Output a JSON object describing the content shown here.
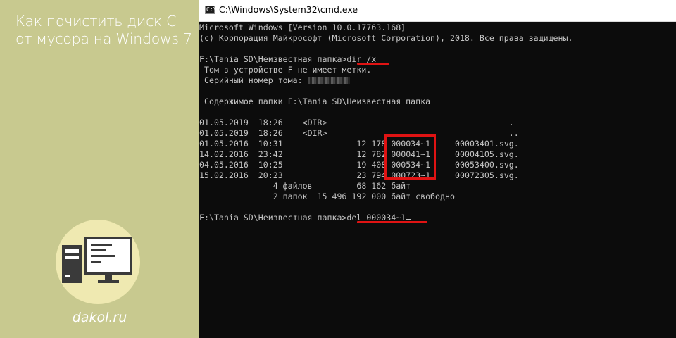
{
  "sidebar": {
    "title": "Как почистить диск С от мусора на Windows 7",
    "site": "dakol.ru",
    "logo_icon": "computer-icon"
  },
  "window": {
    "title": "C:\\Windows\\System32\\cmd.exe",
    "icon": "cmd-icon",
    "icon_glyph": "C:\\"
  },
  "console": {
    "version": "Microsoft Windows [Version 10.0.17763.168]",
    "copyright": "(c) Корпорация Майкрософт (Microsoft Corporation), 2018. Все права защищены.",
    "prompt1": "F:\\Tania SD\\Неизвестная папка>",
    "command1": "dir /x",
    "volume_label": " Том в устройстве F не имеет метки.",
    "serial_label": " Серийный номер тома: ",
    "folder_contents": " Содержимое папки F:\\Tania SD\\Неизвестная папка",
    "rows": [
      {
        "date": "01.05.2019",
        "time": "18:26",
        "dir": "<DIR>",
        "size": "",
        "short": "",
        "name": "."
      },
      {
        "date": "01.05.2019",
        "time": "18:26",
        "dir": "<DIR>",
        "size": "",
        "short": "",
        "name": ".."
      },
      {
        "date": "01.05.2016",
        "time": "10:31",
        "dir": "",
        "size": "12 178",
        "short": "000034~1",
        "name": "00003401.svg."
      },
      {
        "date": "14.02.2016",
        "time": "23:42",
        "dir": "",
        "size": "12 782",
        "short": "000041~1",
        "name": "00004105.svg."
      },
      {
        "date": "04.05.2016",
        "time": "10:25",
        "dir": "",
        "size": "19 408",
        "short": "000534~1",
        "name": "00053400.svg."
      },
      {
        "date": "15.02.2016",
        "time": "20:23",
        "dir": "",
        "size": "23 794",
        "short": "000723~1",
        "name": "00072305.svg."
      }
    ],
    "summary_files": "               4 файлов         68 162 байт",
    "summary_dirs": "               2 папок  15 496 192 000 байт свободно",
    "prompt2": "F:\\Tania SD\\Неизвестная папка>",
    "command2": "del 000034~1"
  },
  "colors": {
    "sidebar_bg": "#c8c98f",
    "console_bg": "#0c0c0c",
    "console_text": "#c4c4c4",
    "highlight": "#e01313"
  }
}
